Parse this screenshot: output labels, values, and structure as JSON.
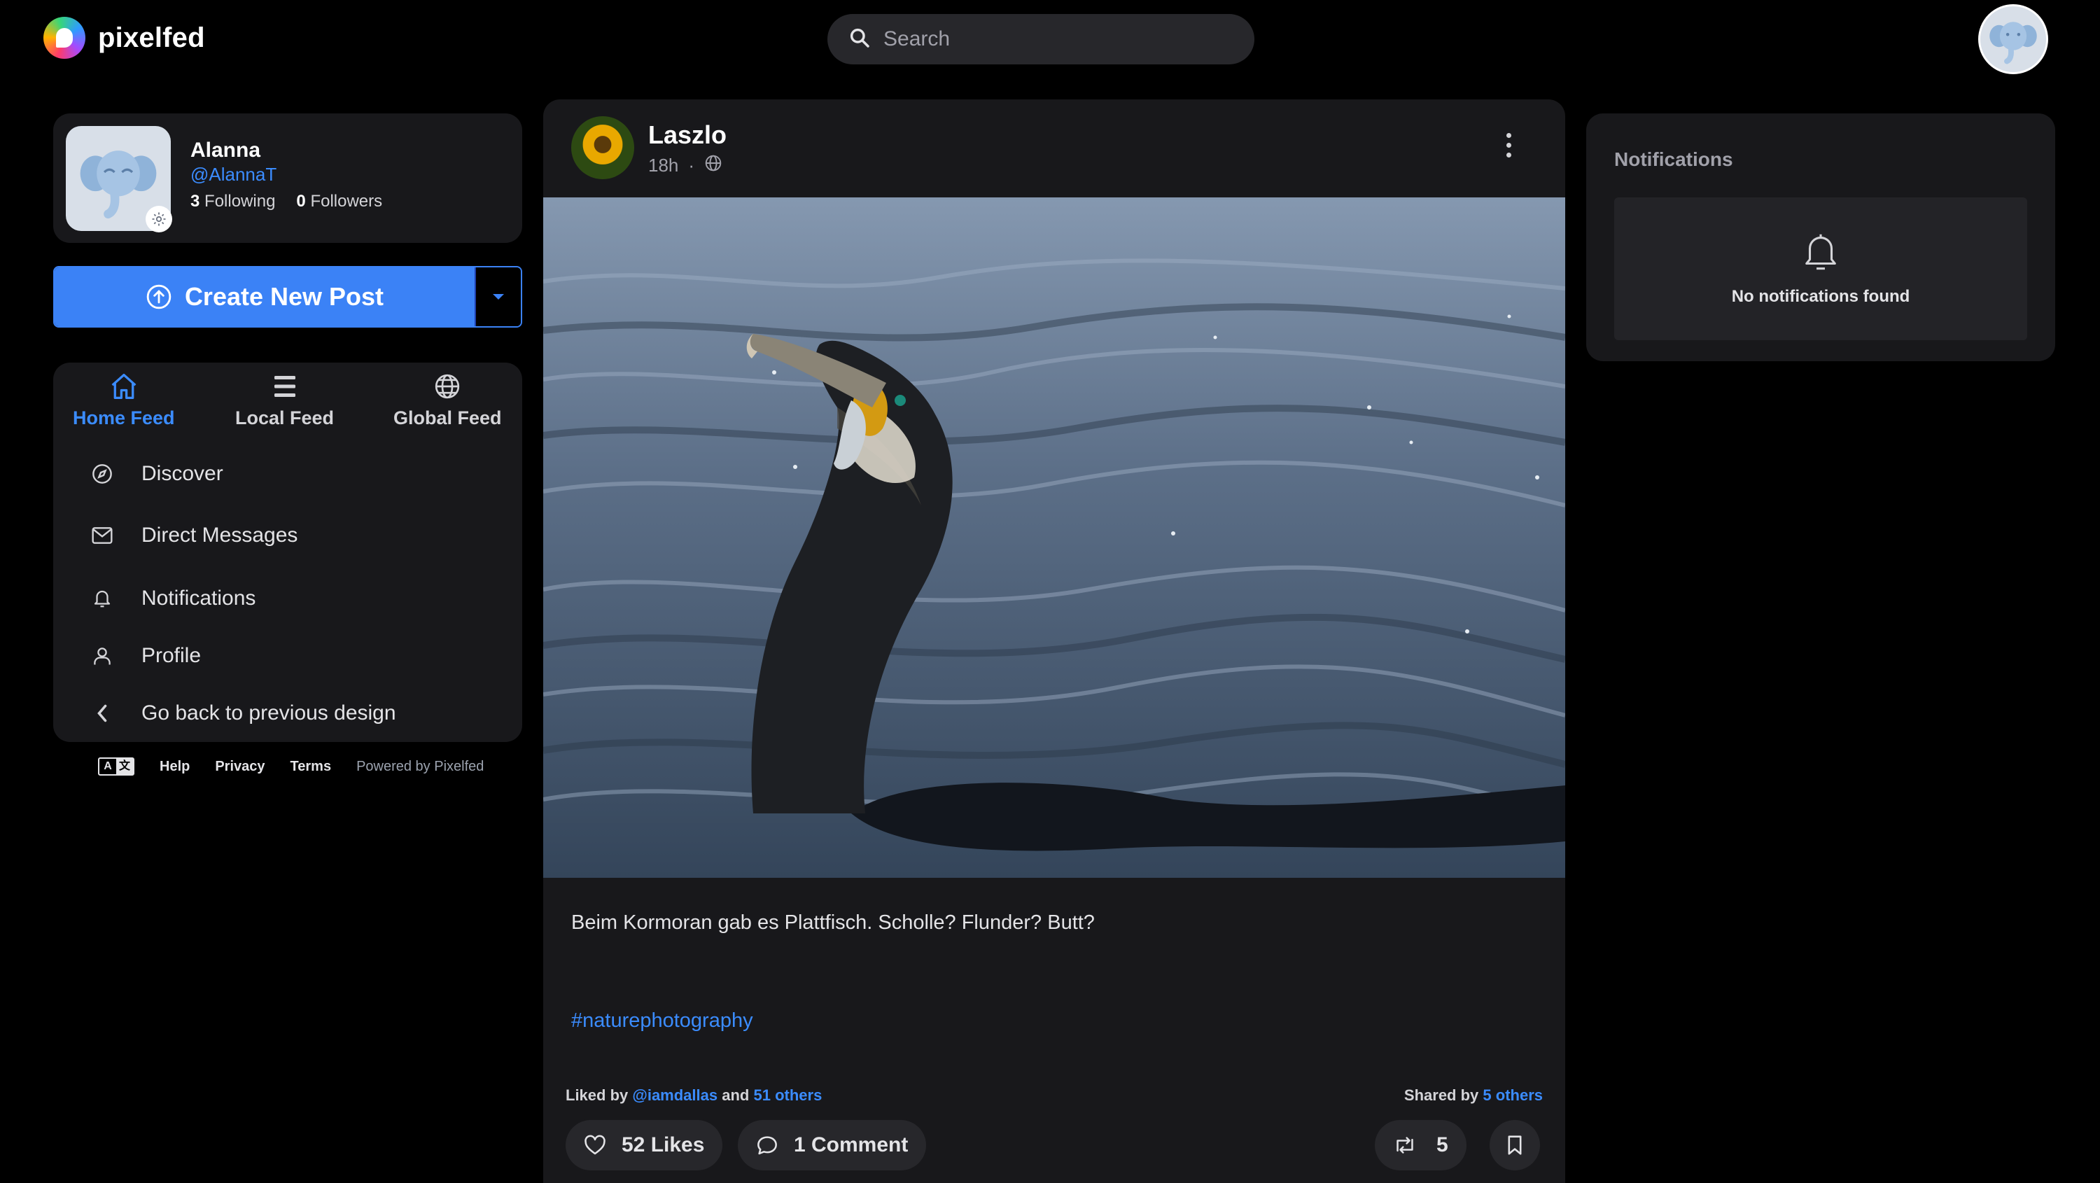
{
  "brand": {
    "name": "pixelfed"
  },
  "search": {
    "placeholder": "Search"
  },
  "profile": {
    "name": "Alanna",
    "handle": "@AlannaT",
    "following_count": "3",
    "following_label": "Following",
    "followers_count": "0",
    "followers_label": "Followers"
  },
  "create": {
    "label": "Create New Post"
  },
  "feeds": [
    {
      "label": "Home Feed",
      "icon": "home-icon",
      "active": true
    },
    {
      "label": "Local Feed",
      "icon": "list-icon",
      "active": false
    },
    {
      "label": "Global Feed",
      "icon": "globe-icon",
      "active": false
    }
  ],
  "nav": [
    {
      "label": "Discover",
      "icon": "compass-icon"
    },
    {
      "label": "Direct Messages",
      "icon": "envelope-icon"
    },
    {
      "label": "Notifications",
      "icon": "bell-icon"
    },
    {
      "label": "Profile",
      "icon": "user-icon"
    },
    {
      "label": "Go back to previous design",
      "icon": "chevron-left-icon"
    }
  ],
  "footer": {
    "lang_a": "A",
    "lang_b": "文",
    "help": "Help",
    "privacy": "Privacy",
    "terms": "Terms",
    "powered": "Powered by Pixelfed"
  },
  "post": {
    "author": "Laszlo",
    "time": "18h",
    "separator": "·",
    "caption": "Beim Kormoran gab es Plattfisch. Scholle? Flunder? Butt?",
    "hashtag": "#naturephotography",
    "liked_by_prefix": "Liked by",
    "liked_by_user": "@iamdallas",
    "liked_by_and": "and",
    "liked_by_others": "51 others",
    "shared_by_prefix": "Shared by",
    "shared_by_others": "5 others",
    "likes_label": "52 Likes",
    "comments_label": "1 Comment",
    "shares_count": "5"
  },
  "notifications": {
    "title": "Notifications",
    "empty": "No notifications found"
  },
  "colors": {
    "accent": "#3b82f6",
    "link": "#3b8cff",
    "card": "#18181b",
    "background": "#000000"
  }
}
